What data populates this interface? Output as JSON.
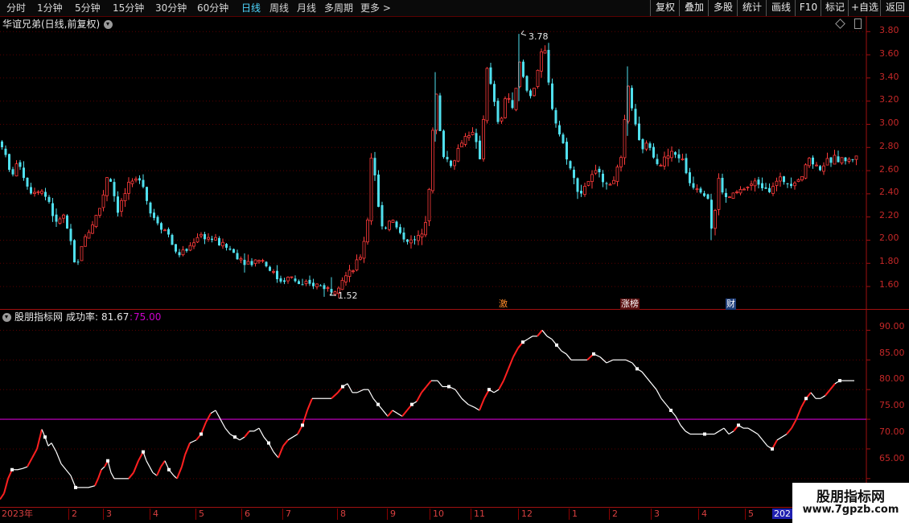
{
  "toolbar": {
    "periods": [
      "分时",
      "1分钟",
      "5分钟",
      "15分钟",
      "30分钟",
      "60分钟",
      "日线",
      "周线",
      "月线",
      "多周期",
      "更多 >"
    ],
    "active_period": "日线",
    "tools": [
      "复权",
      "叠加",
      "多股",
      "统计",
      "画线",
      "F10",
      "标记",
      "+自选",
      "返回"
    ]
  },
  "main_panel": {
    "title": "华谊兄弟(日线,前复权)",
    "price_axis": [
      "3.80",
      "3.60",
      "3.40",
      "3.20",
      "3.00",
      "2.80",
      "2.60",
      "2.40",
      "2.20",
      "2.00",
      "1.80",
      "1.60"
    ],
    "high_marker": "3.78",
    "low_marker": "1.52",
    "events": [
      "激",
      "涨榜",
      "财"
    ]
  },
  "indicator_panel": {
    "name": "股朋指标网",
    "label": "成功率:",
    "value": "81.67",
    "threshold": "75.00",
    "axis": [
      "90.00",
      "85.00",
      "80.00",
      "75.00",
      "70.00",
      "65.00"
    ]
  },
  "date_axis": [
    "2023年",
    "2",
    "3",
    "4",
    "5",
    "6",
    "7",
    "8",
    "9",
    "10",
    "11",
    "12",
    "1",
    "2",
    "3",
    "4",
    "5",
    "202"
  ],
  "watermark": {
    "title": "股朋指标网",
    "url": "www.7gpzb.com"
  },
  "colors": {
    "up": "#ff3b3b",
    "down": "#50e0ee",
    "axis": "#c62828",
    "threshold_line": "#cc00cc",
    "indicator_line": "#ffffff",
    "rising_segment": "#ff2020",
    "active_tab": "#4fd7ff"
  },
  "chart_data": [
    {
      "type": "candlestick",
      "title": "华谊兄弟(日线,前复权)",
      "ylim": [
        1.42,
        3.92
      ],
      "price_path": [
        [
          0,
          2.85
        ],
        [
          12,
          2.55
        ],
        [
          22,
          2.68
        ],
        [
          35,
          2.42
        ],
        [
          48,
          2.45
        ],
        [
          60,
          2.33
        ],
        [
          68,
          2.12
        ],
        [
          76,
          2.24
        ],
        [
          84,
          2.05
        ],
        [
          93,
          1.72
        ],
        [
          100,
          1.96
        ],
        [
          112,
          2.12
        ],
        [
          124,
          2.3
        ],
        [
          133,
          2.6
        ],
        [
          145,
          2.26
        ],
        [
          157,
          2.45
        ],
        [
          166,
          2.5
        ],
        [
          174,
          2.57
        ],
        [
          184,
          2.25
        ],
        [
          196,
          2.15
        ],
        [
          208,
          2.05
        ],
        [
          218,
          1.87
        ],
        [
          232,
          1.92
        ],
        [
          245,
          2.05
        ],
        [
          258,
          2.02
        ],
        [
          270,
          1.98
        ],
        [
          284,
          1.92
        ],
        [
          296,
          1.85
        ],
        [
          310,
          1.8
        ],
        [
          322,
          1.85
        ],
        [
          334,
          1.75
        ],
        [
          346,
          1.65
        ],
        [
          360,
          1.68
        ],
        [
          374,
          1.6
        ],
        [
          388,
          1.62
        ],
        [
          402,
          1.6
        ],
        [
          412,
          1.56
        ],
        [
          424,
          1.67
        ],
        [
          436,
          1.72
        ],
        [
          448,
          1.88
        ],
        [
          456,
          2.2
        ],
        [
          461,
          2.85
        ],
        [
          468,
          2.3
        ],
        [
          476,
          2.08
        ],
        [
          484,
          2.2
        ],
        [
          496,
          2.05
        ],
        [
          510,
          1.98
        ],
        [
          520,
          2.02
        ],
        [
          530,
          2.25
        ],
        [
          536,
          2.9
        ],
        [
          541,
          3.25
        ],
        [
          548,
          2.75
        ],
        [
          560,
          2.65
        ],
        [
          572,
          2.85
        ],
        [
          584,
          2.95
        ],
        [
          596,
          2.7
        ],
        [
          604,
          3.5
        ],
        [
          612,
          3.2
        ],
        [
          620,
          2.95
        ],
        [
          628,
          3.3
        ],
        [
          636,
          3.1
        ],
        [
          645,
          3.55
        ],
        [
          652,
          3.3
        ],
        [
          660,
          3.25
        ],
        [
          668,
          3.5
        ],
        [
          675,
          3.68
        ],
        [
          682,
          3.25
        ],
        [
          690,
          3.0
        ],
        [
          700,
          2.8
        ],
        [
          710,
          2.55
        ],
        [
          720,
          2.4
        ],
        [
          728,
          2.5
        ],
        [
          736,
          2.55
        ],
        [
          744,
          2.62
        ],
        [
          752,
          2.45
        ],
        [
          760,
          2.52
        ],
        [
          770,
          2.65
        ],
        [
          780,
          3.35
        ],
        [
          786,
          3.05
        ],
        [
          794,
          2.8
        ],
        [
          806,
          2.82
        ],
        [
          818,
          2.65
        ],
        [
          832,
          2.75
        ],
        [
          845,
          2.72
        ],
        [
          856,
          2.5
        ],
        [
          868,
          2.45
        ],
        [
          878,
          2.4
        ],
        [
          884,
          2.05
        ],
        [
          892,
          2.52
        ],
        [
          900,
          2.35
        ],
        [
          912,
          2.4
        ],
        [
          925,
          2.45
        ],
        [
          940,
          2.5
        ],
        [
          955,
          2.45
        ],
        [
          968,
          2.52
        ],
        [
          980,
          2.5
        ],
        [
          995,
          2.55
        ],
        [
          1005,
          2.72
        ],
        [
          1015,
          2.62
        ],
        [
          1025,
          2.66
        ],
        [
          1035,
          2.7
        ],
        [
          1045,
          2.7
        ],
        [
          1055,
          2.68
        ],
        [
          1065,
          2.76
        ]
      ],
      "high": 3.78,
      "low": 1.52
    },
    {
      "type": "line",
      "series": [
        {
          "name": "成功率",
          "points": [
            [
              0,
              61.5
            ],
            [
              5,
              62.5
            ],
            [
              10,
              65
            ],
            [
              15,
              66.5
            ],
            [
              22,
              66.5
            ],
            [
              28,
              66.7
            ],
            [
              34,
              67
            ],
            [
              40,
              68.5
            ],
            [
              46,
              70
            ],
            [
              52,
              73.3
            ],
            [
              56,
              72
            ],
            [
              60,
              70.5
            ],
            [
              64,
              71
            ],
            [
              70,
              69.5
            ],
            [
              76,
              67.5
            ],
            [
              82,
              66.5
            ],
            [
              88,
              65.5
            ],
            [
              94,
              63.5
            ],
            [
              102,
              63.5
            ],
            [
              110,
              63.5
            ],
            [
              118,
              63.8
            ],
            [
              122,
              65
            ],
            [
              126,
              66.5
            ],
            [
              130,
              67
            ],
            [
              134,
              68
            ],
            [
              138,
              66
            ],
            [
              142,
              65
            ],
            [
              150,
              65
            ],
            [
              160,
              65
            ],
            [
              166,
              66
            ],
            [
              172,
              68
            ],
            [
              178,
              69.5
            ],
            [
              182,
              68
            ],
            [
              186,
              67
            ],
            [
              190,
              66
            ],
            [
              195,
              65.5
            ],
            [
              200,
              67
            ],
            [
              205,
              68
            ],
            [
              210,
              66.5
            ],
            [
              216,
              65.5
            ],
            [
              220,
              65
            ],
            [
              226,
              67
            ],
            [
              230,
              69
            ],
            [
              236,
              71
            ],
            [
              244,
              71.5
            ],
            [
              250,
              72.5
            ],
            [
              256,
              74.5
            ],
            [
              262,
              76
            ],
            [
              268,
              76.5
            ],
            [
              274,
              75
            ],
            [
              280,
              73.5
            ],
            [
              286,
              72.5
            ],
            [
              292,
              72
            ],
            [
              298,
              71.5
            ],
            [
              304,
              72
            ],
            [
              310,
              73
            ],
            [
              316,
              73
            ],
            [
              322,
              73.5
            ],
            [
              328,
              72
            ],
            [
              334,
              71
            ],
            [
              340,
              69.5
            ],
            [
              346,
              68.5
            ],
            [
              352,
              70.5
            ],
            [
              358,
              71.5
            ],
            [
              364,
              72
            ],
            [
              370,
              72.5
            ],
            [
              376,
              74
            ],
            [
              382,
              76.5
            ],
            [
              388,
              78.5
            ],
            [
              396,
              78.5
            ],
            [
              404,
              78.5
            ],
            [
              412,
              78.5
            ],
            [
              420,
              79.5
            ],
            [
              426,
              80.5
            ],
            [
              432,
              81
            ],
            [
              438,
              79.5
            ],
            [
              444,
              79.5
            ],
            [
              452,
              80
            ],
            [
              458,
              80
            ],
            [
              464,
              78.5
            ],
            [
              470,
              77.5
            ],
            [
              476,
              76.5
            ],
            [
              482,
              75.5
            ],
            [
              488,
              76.5
            ],
            [
              494,
              76
            ],
            [
              500,
              75.5
            ],
            [
              506,
              76.5
            ],
            [
              512,
              77.5
            ],
            [
              518,
              78
            ],
            [
              524,
              79.5
            ],
            [
              530,
              80.5
            ],
            [
              536,
              81.5
            ],
            [
              544,
              81.5
            ],
            [
              550,
              80.5
            ],
            [
              558,
              80.5
            ],
            [
              566,
              80
            ],
            [
              574,
              78.5
            ],
            [
              582,
              77.5
            ],
            [
              590,
              77
            ],
            [
              596,
              76.5
            ],
            [
              602,
              78.5
            ],
            [
              608,
              80
            ],
            [
              614,
              79.5
            ],
            [
              620,
              80
            ],
            [
              626,
              81.5
            ],
            [
              632,
              83.5
            ],
            [
              638,
              85.5
            ],
            [
              644,
              87
            ],
            [
              650,
              88
            ],
            [
              656,
              88.5
            ],
            [
              662,
              89
            ],
            [
              668,
              89
            ],
            [
              674,
              90
            ],
            [
              680,
              89
            ],
            [
              686,
              88.5
            ],
            [
              692,
              87.5
            ],
            [
              698,
              86.5
            ],
            [
              704,
              86
            ],
            [
              710,
              85
            ],
            [
              716,
              85
            ],
            [
              722,
              85
            ],
            [
              730,
              85
            ],
            [
              738,
              86
            ],
            [
              746,
              85.5
            ],
            [
              754,
              84.5
            ],
            [
              762,
              85
            ],
            [
              770,
              85
            ],
            [
              778,
              85
            ],
            [
              786,
              84.5
            ],
            [
              792,
              83.5
            ],
            [
              798,
              83
            ],
            [
              804,
              82
            ],
            [
              810,
              81
            ],
            [
              816,
              80
            ],
            [
              822,
              78.5
            ],
            [
              828,
              77.5
            ],
            [
              834,
              76.5
            ],
            [
              840,
              75.5
            ],
            [
              846,
              74
            ],
            [
              852,
              73
            ],
            [
              858,
              72.5
            ],
            [
              864,
              72.5
            ],
            [
              870,
              72.5
            ],
            [
              876,
              72.5
            ],
            [
              882,
              72.5
            ],
            [
              888,
              72.5
            ],
            [
              894,
              73
            ],
            [
              900,
              73.5
            ],
            [
              906,
              72.5
            ],
            [
              912,
              73
            ],
            [
              918,
              74
            ],
            [
              924,
              73.5
            ],
            [
              930,
              73.5
            ],
            [
              936,
              73
            ],
            [
              942,
              72.5
            ],
            [
              948,
              71.5
            ],
            [
              954,
              70.5
            ],
            [
              960,
              70
            ],
            [
              966,
              71.5
            ],
            [
              972,
              72
            ],
            [
              978,
              72.5
            ],
            [
              984,
              73.5
            ],
            [
              990,
              75
            ],
            [
              996,
              77
            ],
            [
              1002,
              78.5
            ],
            [
              1008,
              79.5
            ],
            [
              1014,
              78.5
            ],
            [
              1020,
              78.5
            ],
            [
              1026,
              79
            ],
            [
              1032,
              80
            ],
            [
              1038,
              81
            ],
            [
              1044,
              81.5
            ],
            [
              1052,
              81.5
            ],
            [
              1062,
              81.5
            ]
          ]
        }
      ],
      "threshold": 75.0,
      "ylim": [
        60.5,
        92.5
      ]
    }
  ]
}
